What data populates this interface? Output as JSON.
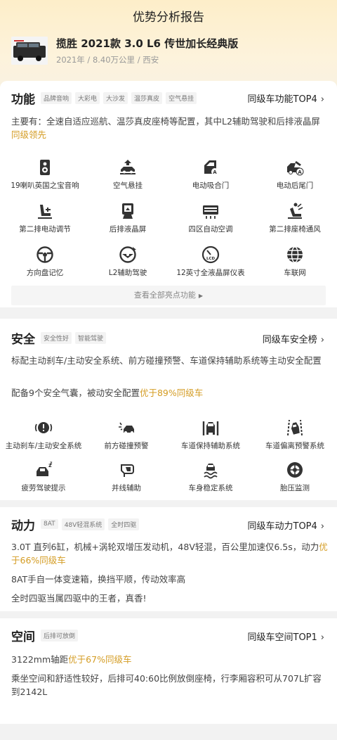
{
  "header": {
    "title": "优势分析报告"
  },
  "car": {
    "name": "揽胜 2021款 3.0 L6 传世加长经典版",
    "meta": "2021年 / 8.40万公里 / 西安",
    "thumb_icon": "car-thumbnail"
  },
  "function": {
    "title": "功能",
    "tags": [
      "品牌音响",
      "大彩电",
      "大沙发",
      "温莎真皮",
      "空气悬挂"
    ],
    "rank": "同级车功能TOP4",
    "desc_prefix": "主要有：全速自适应巡航、温莎真皮座椅等配置，其中L2辅助驾驶和后排液晶屏",
    "desc_hl": "同级领先",
    "features": [
      {
        "label": "19喇叭英国之宝音响",
        "icon": "speaker-icon"
      },
      {
        "label": "空气悬挂",
        "icon": "air-suspension-icon"
      },
      {
        "label": "电动吸合门",
        "icon": "soft-close-door-icon"
      },
      {
        "label": "电动后尾门",
        "icon": "power-tailgate-icon"
      },
      {
        "label": "第二排电动调节",
        "icon": "seat-adjust-icon"
      },
      {
        "label": "后排液晶屏",
        "icon": "rear-screen-icon"
      },
      {
        "label": "四区自动空调",
        "icon": "climate-icon"
      },
      {
        "label": "第二排座椅通风",
        "icon": "seat-ventilation-icon"
      },
      {
        "label": "方向盘记忆",
        "icon": "steering-memory-icon"
      },
      {
        "label": "L2辅助驾驶",
        "icon": "l2-assist-icon"
      },
      {
        "label": "12英寸全液晶屏仪表",
        "icon": "lcd-cluster-icon"
      },
      {
        "label": "车联网",
        "icon": "connected-car-icon"
      }
    ],
    "more_label": "查看全部亮点功能"
  },
  "safety": {
    "title": "安全",
    "tags": [
      "安全性好",
      "智能驾驶"
    ],
    "rank": "同级车安全榜",
    "p1": "标配主动刹车/主动安全系统、前方碰撞预警、车道保持辅助系统等主动安全配置",
    "p2_prefix": "配备9个安全气囊，被动安全配置",
    "p2_hl": "优于89%同级车",
    "features": [
      {
        "label": "主动刹车/主动安全系统",
        "icon": "auto-brake-icon"
      },
      {
        "label": "前方碰撞预警",
        "icon": "collision-warning-icon"
      },
      {
        "label": "车道保持辅助系统",
        "icon": "lane-keep-icon"
      },
      {
        "label": "车道偏离预警系统",
        "icon": "lane-departure-icon"
      },
      {
        "label": "疲劳驾驶提示",
        "icon": "fatigue-icon"
      },
      {
        "label": "并线辅助",
        "icon": "blind-spot-icon"
      },
      {
        "label": "车身稳定系统",
        "icon": "stability-icon"
      },
      {
        "label": "胎压监测",
        "icon": "tire-pressure-icon"
      }
    ]
  },
  "power": {
    "title": "动力",
    "tags": [
      "8AT",
      "48V轻混系统",
      "全时四驱"
    ],
    "rank": "同级车动力TOP4",
    "p1_prefix": "3.0T 直列6缸，机械+涡轮双增压发动机，48V轻混，百公里加速仅6.5s，动力",
    "p1_hl": "优于66%同级车",
    "p2": "8AT手自一体变速箱，换挡平顺，传动效率高",
    "p3": "全时四驱当属四驱中的王者，真香!"
  },
  "space": {
    "title": "空间",
    "tags": [
      "后排可放倒"
    ],
    "rank": "同级车空间TOP1",
    "p1_prefix": "3122mm轴距",
    "p1_hl": "优于67%同级车",
    "p2": "乘坐空间和舒适性较好，后排可40:60比例放倒座椅，行李厢容积可从707L扩容到2142L"
  },
  "colors": {
    "accent": "#d49c23",
    "icon": "#333333"
  }
}
